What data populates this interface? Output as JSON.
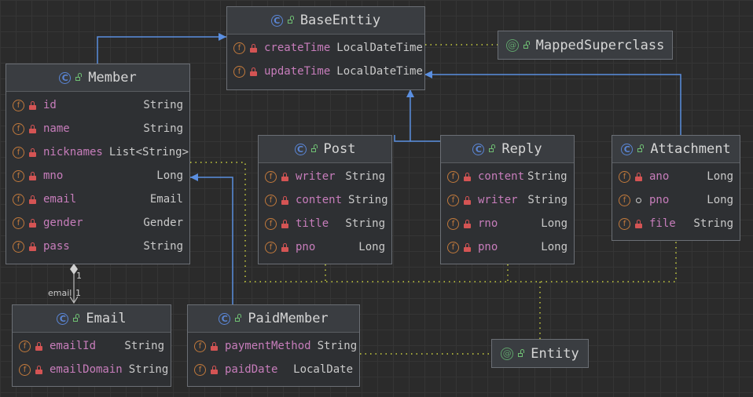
{
  "diagram": {
    "classes": {
      "base": {
        "name": "BaseEnttiy",
        "fields": [
          {
            "name": "createTime",
            "type": "LocalDateTime",
            "visibility": "private"
          },
          {
            "name": "updateTime",
            "type": "LocalDateTime",
            "visibility": "private"
          }
        ]
      },
      "member": {
        "name": "Member",
        "fields": [
          {
            "name": "id",
            "type": "String",
            "visibility": "private"
          },
          {
            "name": "name",
            "type": "String",
            "visibility": "private"
          },
          {
            "name": "nicknames",
            "type": "List<String>",
            "visibility": "private"
          },
          {
            "name": "mno",
            "type": "Long",
            "visibility": "private"
          },
          {
            "name": "email",
            "type": "Email",
            "visibility": "private"
          },
          {
            "name": "gender",
            "type": "Gender",
            "visibility": "private"
          },
          {
            "name": "pass",
            "type": "String",
            "visibility": "private"
          }
        ]
      },
      "post": {
        "name": "Post",
        "fields": [
          {
            "name": "writer",
            "type": "String",
            "visibility": "private"
          },
          {
            "name": "content",
            "type": "String",
            "visibility": "private"
          },
          {
            "name": "title",
            "type": "String",
            "visibility": "private"
          },
          {
            "name": "pno",
            "type": "Long",
            "visibility": "private"
          }
        ]
      },
      "reply": {
        "name": "Reply",
        "fields": [
          {
            "name": "content",
            "type": "String",
            "visibility": "private"
          },
          {
            "name": "writer",
            "type": "String",
            "visibility": "private"
          },
          {
            "name": "rno",
            "type": "Long",
            "visibility": "private"
          },
          {
            "name": "pno",
            "type": "Long",
            "visibility": "private"
          }
        ]
      },
      "attachment": {
        "name": "Attachment",
        "fields": [
          {
            "name": "ano",
            "type": "Long",
            "visibility": "private"
          },
          {
            "name": "pno",
            "type": "Long",
            "visibility": "package"
          },
          {
            "name": "file",
            "type": "String",
            "visibility": "private"
          }
        ]
      },
      "email": {
        "name": "Email",
        "fields": [
          {
            "name": "emailId",
            "type": "String",
            "visibility": "private"
          },
          {
            "name": "emailDomain",
            "type": "String",
            "visibility": "private"
          }
        ]
      },
      "paidMember": {
        "name": "PaidMember",
        "fields": [
          {
            "name": "paymentMethod",
            "type": "String",
            "visibility": "private"
          },
          {
            "name": "paidDate",
            "type": "LocalDate",
            "visibility": "private"
          }
        ]
      }
    },
    "annotations": {
      "mapped": {
        "name": "MappedSuperclass"
      },
      "entity": {
        "name": "Entity"
      }
    },
    "composition": {
      "source_multiplicity": "1",
      "target_role": "email",
      "target_multiplicity": "1"
    },
    "colors": {
      "background": "#2b2b2b",
      "inheritance_line": "#5b8fe0",
      "annotation_line": "#a4a83a",
      "composition_line": "#bbbbbb",
      "field_name": "#c77dbb"
    }
  }
}
